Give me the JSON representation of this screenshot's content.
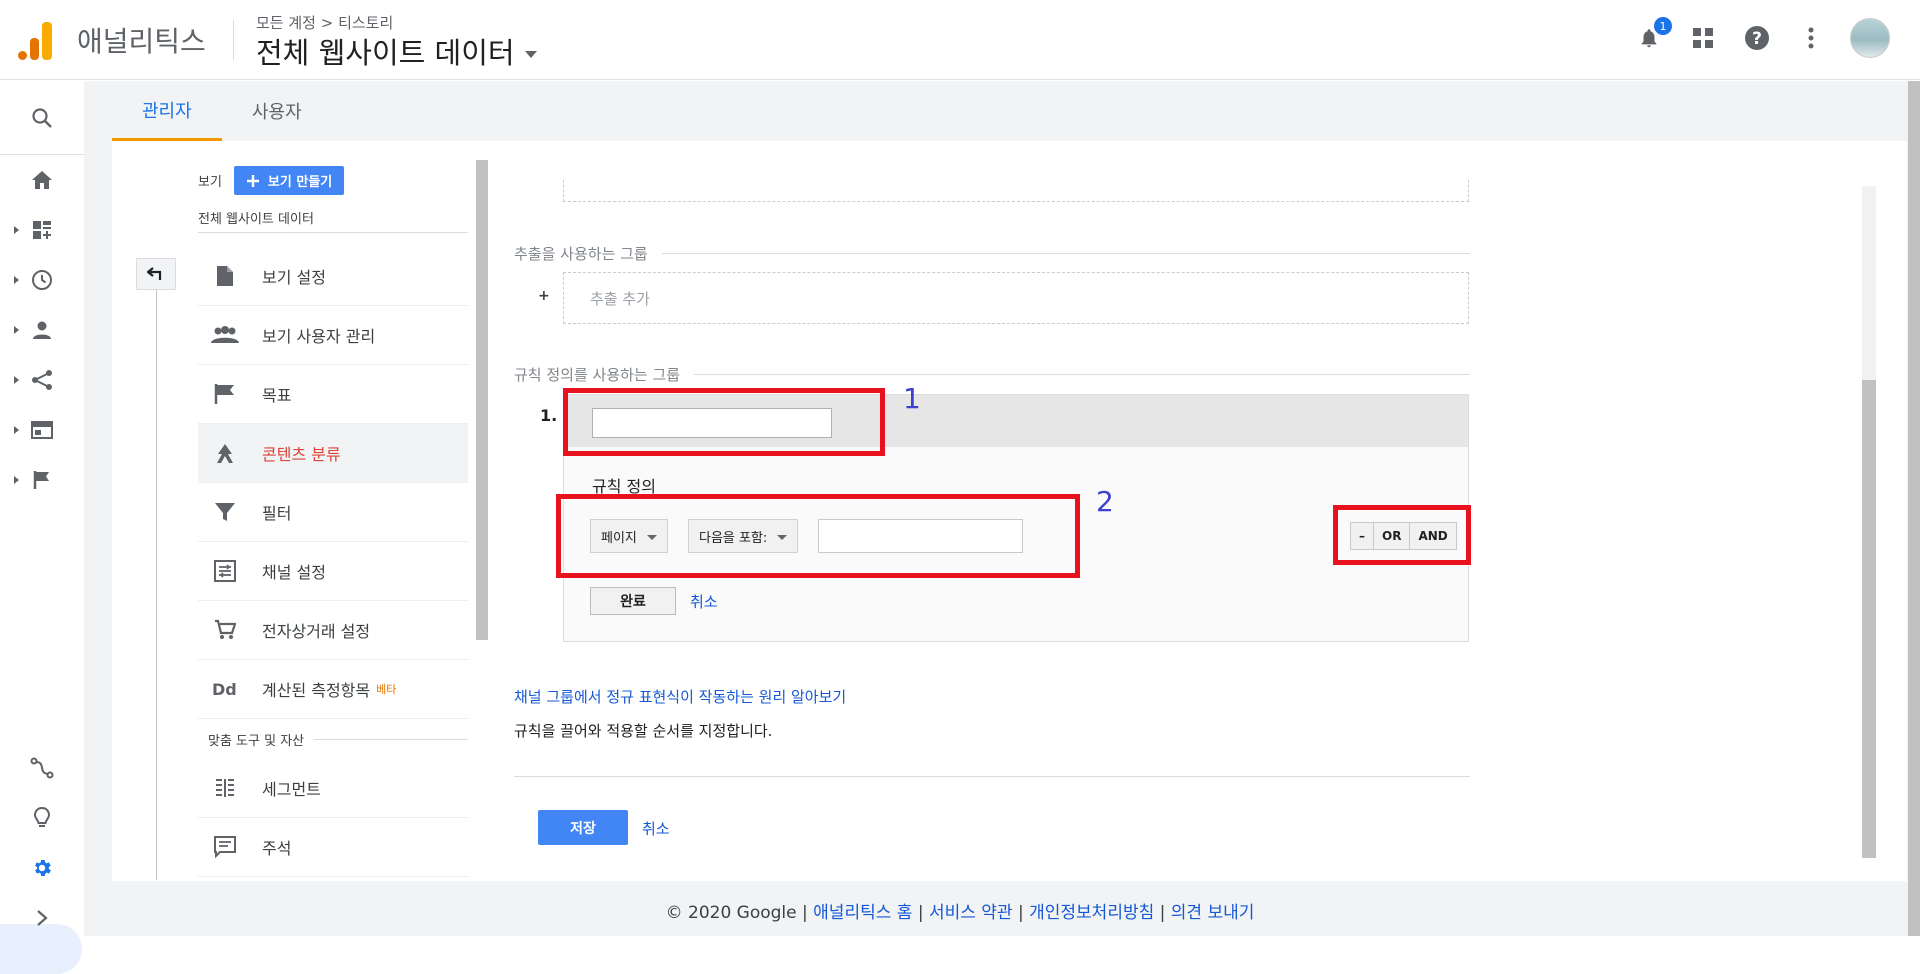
{
  "header": {
    "product": "애널리틱스",
    "breadcrumb": "모든 계정 > 티스토리",
    "view_title": "전체 웹사이트 데이터",
    "notification_count": "1",
    "icons": [
      "bell-icon",
      "apps-icon",
      "help-icon",
      "more-vert-icon"
    ]
  },
  "tabs": [
    {
      "label": "관리자",
      "active": true
    },
    {
      "label": "사용자",
      "active": false
    }
  ],
  "admin": {
    "view_label": "보기",
    "create_view": "보기 만들기",
    "view_name": "전체 웹사이트 데이터",
    "nav": [
      {
        "label": "보기 설정",
        "icon": "document-icon"
      },
      {
        "label": "보기 사용자 관리",
        "icon": "people-icon"
      },
      {
        "label": "목표",
        "icon": "flag-icon"
      },
      {
        "label": "콘텐츠 분류",
        "icon": "content-grouping-icon",
        "active": true
      },
      {
        "label": "필터",
        "icon": "filter-icon"
      },
      {
        "label": "채널 설정",
        "icon": "channel-settings-icon"
      },
      {
        "label": "전자상거래 설정",
        "icon": "cart-icon"
      },
      {
        "label": "계산된 측정항목",
        "icon": "dd-icon",
        "badge": "베타"
      }
    ],
    "section": "맞춤 도구 및 자산",
    "tools": [
      {
        "label": "세그먼트",
        "icon": "segment-icon"
      },
      {
        "label": "주석",
        "icon": "comment-icon"
      }
    ]
  },
  "form": {
    "extract_section": "추출을 사용하는 그룹",
    "extract_add": "추출 추가",
    "plus": "+",
    "rules_section": "규칙 정의를 사용하는 그룹",
    "rule_number": "1.",
    "rule_name_value": "",
    "rule_definition": "규칙 정의",
    "dimension": "페이지",
    "match_type": "다음을 포함:",
    "match_value": "",
    "logic": {
      "minus": "–",
      "or": "OR",
      "and": "AND"
    },
    "done": "완료",
    "cancel": "취소",
    "learn_link": "채널 그룹에서 정규 표현식이 작동하는 원리 알아보기",
    "hint": "규칙을 끌어와 적용할 순서를 지정합니다.",
    "save": "저장",
    "cancel2": "취소"
  },
  "annotations": {
    "one": "1",
    "two": "2",
    "color": "#e8121e"
  },
  "footer": {
    "copyright": "© 2020 Google",
    "sep": "|",
    "links": [
      "애널리틱스 홈",
      "서비스 약관",
      "개인정보처리방침",
      "의견 보내기"
    ]
  },
  "colors": {
    "accent": "#1a73e8",
    "active_nav": "#db4437",
    "save": "#4285f4",
    "tab_underline": "#f29900"
  }
}
